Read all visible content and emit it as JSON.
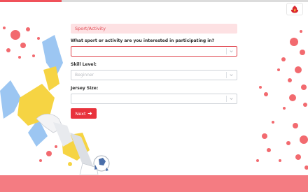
{
  "progress": {
    "fraction": 0.2
  },
  "brand": {
    "logo_icon": "flame-emblem-icon",
    "accent_color": "#e8323c"
  },
  "section": {
    "title": "Sport/Activity"
  },
  "questions": [
    {
      "label": "What sport or activity are you interested in participating in?",
      "value": "",
      "placeholder": ""
    },
    {
      "label": "Skill Level:",
      "value": "Beginner",
      "placeholder": "Beginner"
    },
    {
      "label": "Jersey Size:",
      "value": "",
      "placeholder": ""
    }
  ],
  "actions": {
    "next_label": "Next",
    "next_icon": "arrow-right-icon"
  }
}
